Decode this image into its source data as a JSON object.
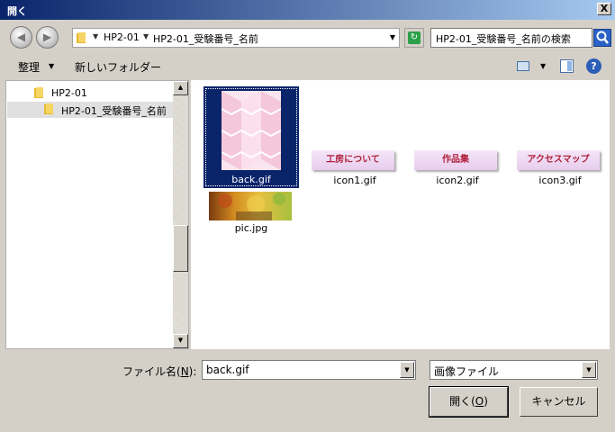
{
  "window": {
    "title": "開く",
    "close_glyph": "X"
  },
  "nav": {
    "back_glyph": "◀",
    "forward_glyph": "▶",
    "breadcrumbs": [
      "HP2-01",
      "HP2-01_受験番号_名前"
    ],
    "search_placeholder": "HP2-01_受験番号_名前の検索"
  },
  "toolbar": {
    "organize_label": "整理",
    "new_folder_label": "新しいフォルダー",
    "help_glyph": "?"
  },
  "tree": {
    "items": [
      {
        "label": "HP2-01"
      },
      {
        "label": "HP2-01_受験番号_名前"
      }
    ]
  },
  "files": {
    "items": [
      {
        "name": "back.gif"
      },
      {
        "name": "icon1.gif",
        "banner": "工房について"
      },
      {
        "name": "icon2.gif",
        "banner": "作品集"
      },
      {
        "name": "icon3.gif",
        "banner": "アクセスマップ"
      },
      {
        "name": "pic.jpg"
      }
    ]
  },
  "bottom": {
    "filename_label": "ファイル名(",
    "filename_key": "N",
    "filename_label_end": "):",
    "filename_value": "back.gif",
    "filetype_value": "画像ファイル",
    "open_label": "開く(",
    "open_key": "O",
    "open_label_end": ")",
    "cancel_label": "キャンセル"
  },
  "colors": {
    "titlebar": "#0a246a",
    "selection": "#0a246a",
    "banner_text": "#b0203c"
  }
}
